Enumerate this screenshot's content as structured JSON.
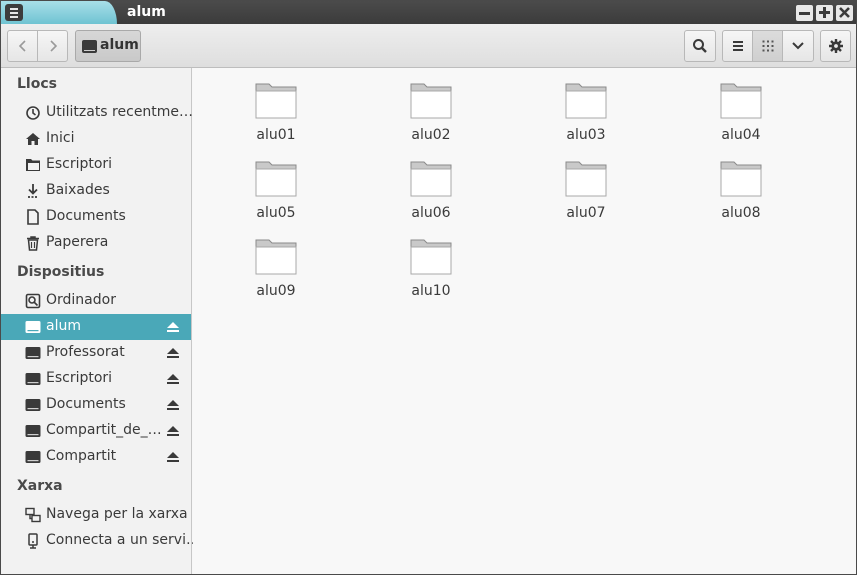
{
  "window": {
    "title": "alum"
  },
  "header": {
    "path_label": "alum"
  },
  "sidebar": {
    "sections": [
      {
        "title": "Llocs"
      },
      {
        "title": "Dispositius"
      },
      {
        "title": "Xarxa"
      }
    ],
    "places": [
      {
        "label": "Utilitzats recentme…",
        "icon": "clock-icon"
      },
      {
        "label": "Inici",
        "icon": "home-icon"
      },
      {
        "label": "Escriptori",
        "icon": "desktop-folder-icon"
      },
      {
        "label": "Baixades",
        "icon": "download-icon"
      },
      {
        "label": "Documents",
        "icon": "document-icon"
      },
      {
        "label": "Paperera",
        "icon": "trash-icon"
      }
    ],
    "devices": [
      {
        "label": "Ordinador",
        "icon": "computer-icon"
      },
      {
        "label": "alum",
        "icon": "drive-icon",
        "selected": true
      },
      {
        "label": "Professorat",
        "icon": "drive-icon"
      },
      {
        "label": "Escriptori",
        "icon": "drive-icon"
      },
      {
        "label": "Documents",
        "icon": "drive-icon"
      },
      {
        "label": "Compartit_de_…",
        "icon": "drive-icon"
      },
      {
        "label": "Compartit",
        "icon": "drive-icon"
      }
    ],
    "network": [
      {
        "label": "Navega per la xarxa",
        "icon": "network-icon"
      },
      {
        "label": "Connecta a un servi…",
        "icon": "server-icon"
      }
    ]
  },
  "folders": [
    "alu01",
    "alu02",
    "alu03",
    "alu04",
    "alu05",
    "alu06",
    "alu07",
    "alu08",
    "alu09",
    "alu10"
  ],
  "colors": {
    "accent": "#4aa8b8",
    "titlebar": "#3b3b3b",
    "tab": "#7cc8d6"
  }
}
